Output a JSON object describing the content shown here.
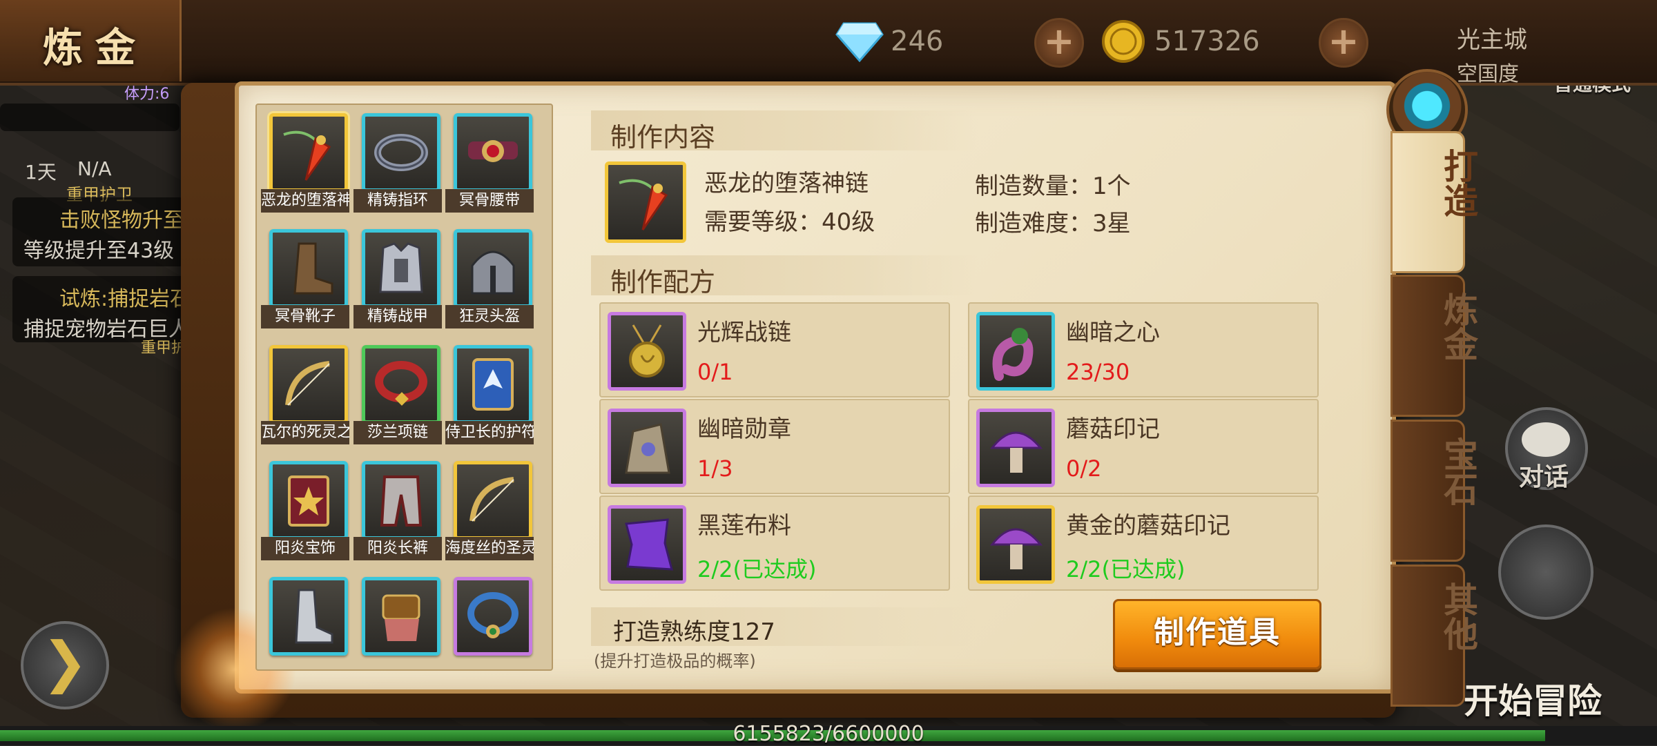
{
  "topbar": {
    "title": "炼金",
    "diamonds": "246",
    "gold": "517326",
    "area_line1": "光主城",
    "area_line2": "空国度",
    "mode": "普通模式"
  },
  "hud_left": {
    "stamina": "体力:6",
    "buff1_label": "1天",
    "buff2_label": "N/A",
    "guard": "重甲护卫",
    "quest1_title": "击败怪物升至",
    "quest1_desc": "等级提升至43级",
    "quest2_title": "试炼:捕捉岩石",
    "quest2_desc": "捕捉宠物岩石巨人",
    "guard2": "重甲护"
  },
  "items": [
    {
      "name": "恶龙的堕落神链",
      "icon": "pendant-icon",
      "rarity": "gold"
    },
    {
      "name": "精铸指环",
      "icon": "ring-icon",
      "rarity": "cyan"
    },
    {
      "name": "冥骨腰带",
      "icon": "belt-icon",
      "rarity": "cyan"
    },
    {
      "name": "冥骨靴子",
      "icon": "boots-icon",
      "rarity": "cyan"
    },
    {
      "name": "精铸战甲",
      "icon": "armor-icon",
      "rarity": "cyan"
    },
    {
      "name": "狂灵头盔",
      "icon": "helmet-icon",
      "rarity": "cyan"
    },
    {
      "name": "瓦尔的死灵之弓",
      "icon": "bow-icon",
      "rarity": "gold"
    },
    {
      "name": "莎兰项链",
      "icon": "collar-icon",
      "rarity": "green"
    },
    {
      "name": "侍卫长的护符",
      "icon": "charm-icon",
      "rarity": "cyan"
    },
    {
      "name": "阳炎宝饰",
      "icon": "book-icon",
      "rarity": "cyan"
    },
    {
      "name": "阳炎长裤",
      "icon": "pants-icon",
      "rarity": "cyan"
    },
    {
      "name": "海度丝的圣灵之弓",
      "icon": "bow-icon",
      "rarity": "gold"
    },
    {
      "name": "",
      "icon": "greaves-icon",
      "rarity": "cyan"
    },
    {
      "name": "",
      "icon": "gauntlet-icon",
      "rarity": "cyan"
    },
    {
      "name": "",
      "icon": "necklace-icon",
      "rarity": "purple"
    }
  ],
  "craft": {
    "content_header": "制作内容",
    "item_name": "恶龙的堕落神链",
    "level_req": "需要等级：40级",
    "quantity": "制造数量：1个",
    "difficulty": "制造难度：3星",
    "recipe_header": "制作配方",
    "materials": [
      {
        "name": "光辉战链",
        "count": "0/1",
        "done": false,
        "icon": "medallion-icon",
        "rarity": "purple"
      },
      {
        "name": "幽暗之心",
        "count": "23/30",
        "done": false,
        "icon": "tentacle-icon",
        "rarity": "cyan"
      },
      {
        "name": "幽暗勋章",
        "count": "1/3",
        "done": false,
        "icon": "stone-orb-icon",
        "rarity": "purple"
      },
      {
        "name": "蘑菇印记",
        "count": "0/2",
        "done": false,
        "icon": "mushroom-icon",
        "rarity": "purple"
      },
      {
        "name": "黑莲布料",
        "count": "2/2(已达成)",
        "done": true,
        "icon": "cloth-icon",
        "rarity": "purple"
      },
      {
        "name": "黄金的蘑菇印记",
        "count": "2/2(已达成)",
        "done": true,
        "icon": "mushroom-icon",
        "rarity": "gold"
      }
    ],
    "proficiency": "打造熟练度127",
    "proficiency_note": "(提升打造极品的概率)",
    "make_button": "制作道具"
  },
  "tabs": [
    {
      "label": "打造",
      "active": true
    },
    {
      "label": "炼金",
      "active": false
    },
    {
      "label": "宝石",
      "active": false
    },
    {
      "label": "其他",
      "active": false
    }
  ],
  "hud_right": {
    "chat": "对话",
    "start": "开始冒险"
  },
  "xp": {
    "text": "6155823/6600000",
    "fraction": 0.9327
  },
  "colors": {
    "fail": "#e31b1b",
    "done": "#1ecb1e",
    "button": "#f08a0c"
  }
}
